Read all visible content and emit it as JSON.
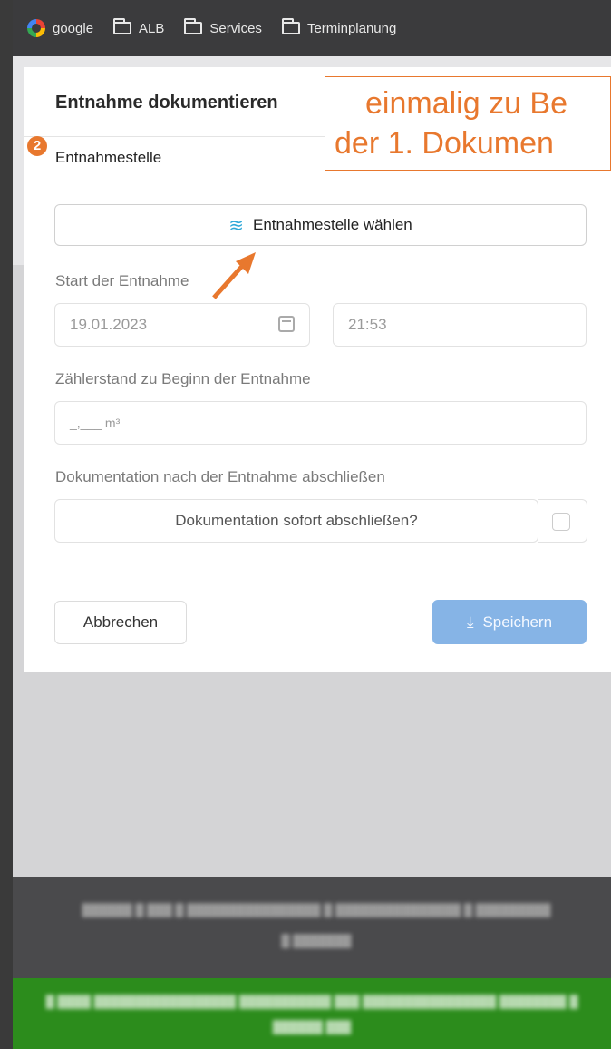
{
  "bookmarks": [
    {
      "label": "google",
      "icon": "google-icon"
    },
    {
      "label": "ALB",
      "icon": "folder-icon"
    },
    {
      "label": "Services",
      "icon": "folder-icon"
    },
    {
      "label": "Terminplanung",
      "icon": "folder-icon"
    }
  ],
  "card": {
    "title": "Entnahme dokumentieren",
    "step_badge": "2",
    "entnahmestelle_label": "Entnahmestelle",
    "entnahmestelle_button": "Entnahmestelle wählen",
    "start_label": "Start der Entnahme",
    "date_value": "19.01.2023",
    "time_value": "21:53",
    "meter_label": "Zählerstand zu Beginn der Entnahme",
    "meter_placeholder": "_,___ m³",
    "doc_label": "Dokumentation nach der Entnahme abschließen",
    "doc_button": "Dokumentation sofort abschließen?",
    "cancel_button": "Abbrechen",
    "save_button": "Speichern"
  },
  "callout": {
    "line1": "einmalig zu Be",
    "line2": "der 1. Dokumen"
  },
  "colors": {
    "accent_orange": "#e8782e",
    "primary_blue": "#86b4e6",
    "footer_green": "#2c8c1c"
  }
}
